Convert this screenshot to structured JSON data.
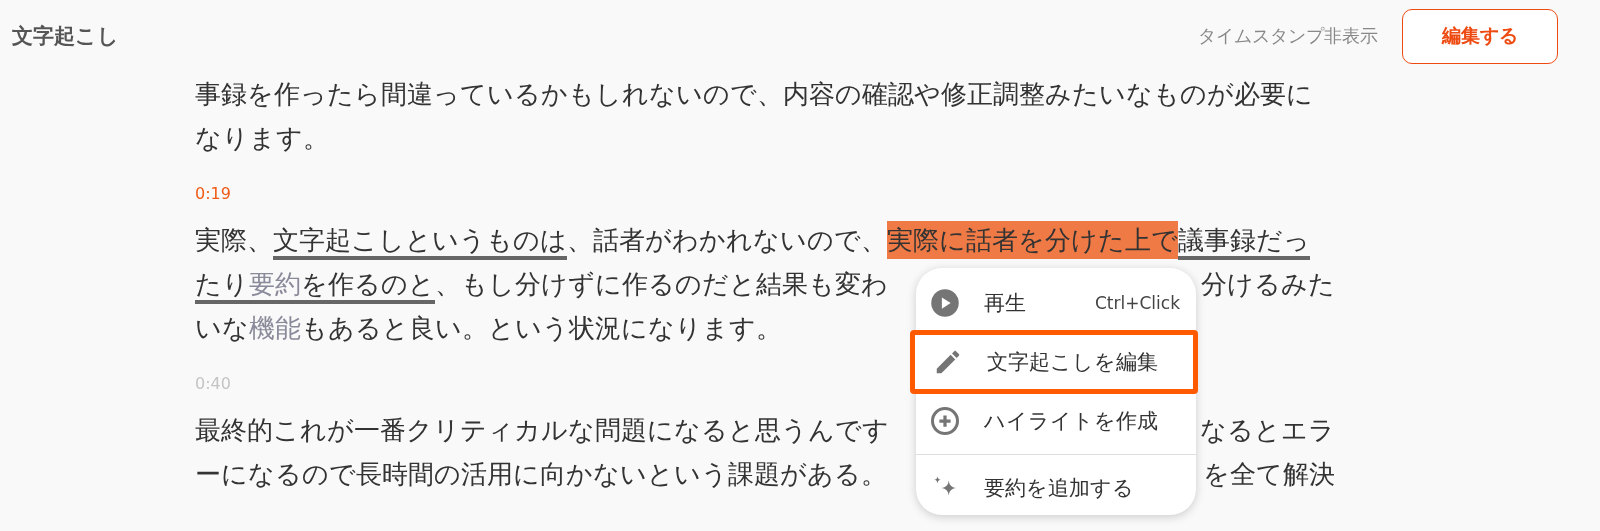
{
  "header": {
    "title": "文字起こし",
    "toggle_label": "タイムスタンプ非表示",
    "edit_button": "編集する"
  },
  "blocks": [
    {
      "lines": [
        {
          "parts": [
            [
              {
                "text": "事録を作ったら間違っているかもしれないので、内容の確認や修正調整みたいなものが必要に",
                "kind": "plain"
              }
            ]
          ]
        },
        {
          "parts": [
            [
              {
                "text": "なります。",
                "kind": "plain"
              }
            ]
          ]
        }
      ]
    },
    {
      "timestamp": {
        "text": "0:19",
        "active": true
      },
      "lines": [
        {
          "parts": [
            [
              {
                "text": "実際、",
                "kind": "plain"
              },
              {
                "text": "文字起こしというものは",
                "kind": "underline"
              },
              {
                "text": "、話者がわかれないので、",
                "kind": "plain"
              },
              {
                "text": "実際に話者を分けた上で",
                "kind": "highlight"
              },
              {
                "text": "議事録だっ",
                "kind": "underline"
              }
            ]
          ]
        },
        {
          "parts": [
            [
              {
                "text": "たり",
                "kind": "underline"
              },
              {
                "text": "要約",
                "kind": "underline_muted"
              },
              {
                "text": "を作るのと",
                "kind": "underline"
              },
              {
                "text": "、もし分けずに作るのだと結果も変わ",
                "kind": "plain"
              }
            ],
            [
              {
                "text": "分けるみた",
                "kind": "plain"
              }
            ]
          ]
        },
        {
          "parts": [
            [
              {
                "text": "いな",
                "kind": "plain"
              },
              {
                "text": "機能",
                "kind": "muted"
              },
              {
                "text": "もあると良い。という状況になります。",
                "kind": "plain"
              }
            ]
          ]
        }
      ]
    },
    {
      "timestamp": {
        "text": "0:40",
        "active": false
      },
      "lines": [
        {
          "parts": [
            [
              {
                "text": "最終的これが一番クリティカルな問題になると思うんです",
                "kind": "plain"
              }
            ],
            [
              {
                "text": "なるとエラ",
                "kind": "plain"
              }
            ]
          ]
        },
        {
          "parts": [
            [
              {
                "text": "ーになるので長時間の活用に向かないという課題がある。",
                "kind": "plain"
              }
            ],
            [
              {
                "text": "を全て解決",
                "kind": "plain"
              }
            ]
          ]
        }
      ]
    }
  ],
  "context_menu": {
    "items": [
      {
        "kind": "play",
        "label": "再生",
        "shortcut": "Ctrl+Click",
        "selected": false,
        "divider_before": false
      },
      {
        "kind": "pencil",
        "label": "文字起こしを編集",
        "selected": true,
        "divider_before": false
      },
      {
        "kind": "plus",
        "label": "ハイライトを作成",
        "selected": false,
        "divider_before": false
      },
      {
        "kind": "sparkle",
        "label": "要約を追加する",
        "selected": false,
        "divider_before": true
      }
    ]
  }
}
